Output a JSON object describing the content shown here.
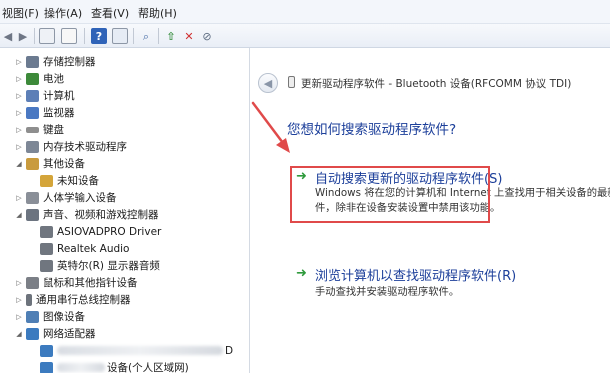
{
  "menu": {
    "view": "视图(F)",
    "action": "操作(A)",
    "look": "查看(V)",
    "help": "帮助(H)"
  },
  "toolbar": {
    "icons": [
      "back-arrow-icon",
      "forward-arrow-icon",
      "properties-icon",
      "console-icon",
      "help-icon",
      "details-icon",
      "scan-hardware-icon",
      "update-driver-icon",
      "uninstall-icon",
      "disable-icon"
    ]
  },
  "tree": {
    "items": [
      {
        "label": "存储控制器",
        "icon": "storage-icon",
        "color": "#6b7a90"
      },
      {
        "label": "电池",
        "icon": "battery-icon",
        "color": "#3d8a3a"
      },
      {
        "label": "计算机",
        "icon": "computer-icon",
        "color": "#5d7fb7"
      },
      {
        "label": "监视器",
        "icon": "monitor-icon",
        "color": "#4a78c2"
      },
      {
        "label": "键盘",
        "icon": "keyboard-icon",
        "color": "#8e8e8e"
      },
      {
        "label": "内存技术驱动程序",
        "icon": "memory-icon",
        "color": "#7d8796"
      },
      {
        "label": "其他设备",
        "icon": "other-devices-icon",
        "color": "#c99b3e"
      },
      {
        "label": "未知设备",
        "icon": "unknown-device-icon",
        "color": "#d4a53a"
      },
      {
        "label": "人体学输入设备",
        "icon": "hid-icon",
        "color": "#8a8f98"
      },
      {
        "label": "声音、视频和游戏控制器",
        "icon": "sound-icon",
        "color": "#6c7480"
      },
      {
        "label": "ASIOVADPRO Driver",
        "icon": "speaker-icon",
        "color": "#70767f"
      },
      {
        "label": "Realtek Audio",
        "icon": "speaker-icon",
        "color": "#70767f"
      },
      {
        "label": "英特尔(R) 显示器音频",
        "icon": "speaker-icon",
        "color": "#70767f"
      },
      {
        "label": "鼠标和其他指针设备",
        "icon": "mouse-icon",
        "color": "#7b7f86"
      },
      {
        "label": "通用串行总线控制器",
        "icon": "usb-icon",
        "color": "#6d737c"
      },
      {
        "label": "图像设备",
        "icon": "camera-icon",
        "color": "#4f7fb5"
      },
      {
        "label": "网络适配器",
        "icon": "network-icon",
        "color": "#3c7bbf"
      },
      {
        "label": "D",
        "icon": "network-adapter-icon",
        "color": "#3c7bbf"
      },
      {
        "label": "设备(个人区域网)",
        "icon": "network-adapter-icon",
        "color": "#3c7bbf"
      }
    ]
  },
  "dialog": {
    "title": "更新驱动程序软件 - Bluetooth 设备(RFCOMM 协议 TDI)",
    "question": "您想如何搜索驱动程序软件?",
    "option1": {
      "title": "自动搜索更新的驱动程序软件(S)",
      "desc_line1": "Windows 将在您的计算机和 Internet 上查找用于相关设备的最新",
      "desc_line2": "件，除非在设备安装设置中禁用该功能。"
    },
    "option2": {
      "title": "浏览计算机以查找驱动程序软件(R)",
      "desc": "手动查找并安装驱动程序软件。"
    }
  },
  "colors": {
    "link": "#1c3f9a",
    "arrow_green": "#2f9a3c",
    "annotation_red": "#e04a4a"
  }
}
